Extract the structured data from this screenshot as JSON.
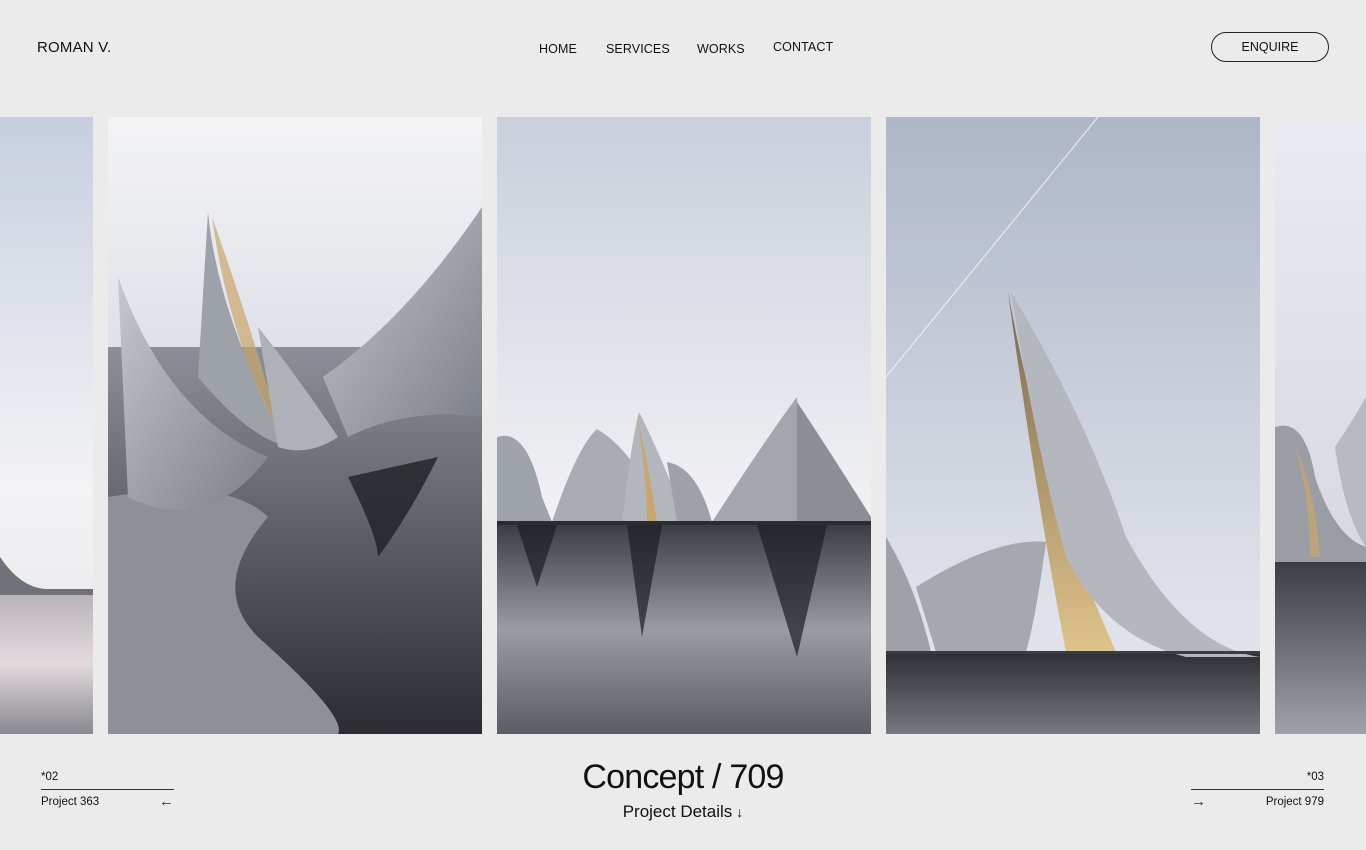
{
  "brand": {
    "name": "ROMAN V."
  },
  "nav": {
    "items": [
      {
        "label": "HOME"
      },
      {
        "label": "SERVICES"
      },
      {
        "label": "WORKS"
      },
      {
        "label": "CONTACT"
      }
    ]
  },
  "header": {
    "enquire_label": "ENQUIRE"
  },
  "current": {
    "title": "Concept / 709",
    "details_label": "Project Details",
    "details_icon": "arrow-down-icon"
  },
  "previous": {
    "number": "*02",
    "label": "Project 363",
    "icon": "arrow-left-icon"
  },
  "next": {
    "number": "*03",
    "label": "Project 979",
    "icon": "arrow-right-icon"
  },
  "colors": {
    "background": "#ebebeb",
    "text": "#111111",
    "concrete": "#b9bcc2",
    "water": "#3a3d44",
    "glow": "#c9a66b"
  }
}
